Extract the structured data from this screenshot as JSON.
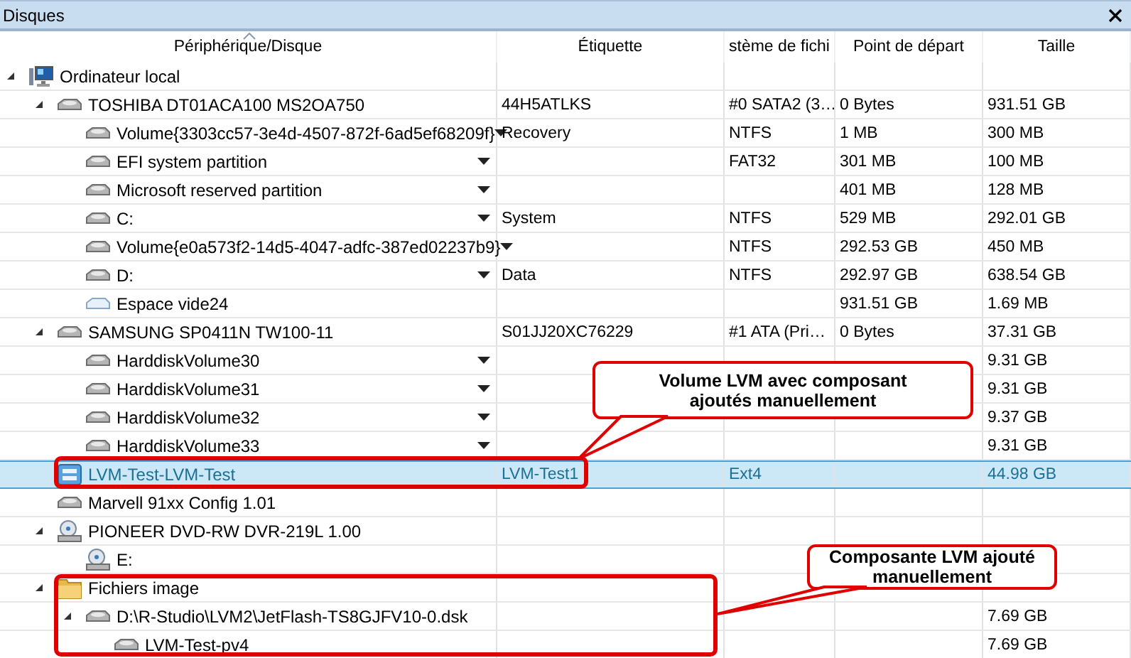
{
  "panel": {
    "title": "Disques"
  },
  "columns": [
    "Périphérique/Disque",
    "Étiquette",
    "stème de fichi",
    "Point de départ",
    "Taille"
  ],
  "tree": [
    {
      "name": "Ordinateur local",
      "kind": "computer",
      "expanded": true,
      "selected": false,
      "menu": false,
      "children": [
        {
          "name": "TOSHIBA DT01ACA100 MS2OA750",
          "kind": "disk",
          "expanded": true,
          "selected": false,
          "menu": false,
          "label": "44H5ATLKS",
          "filesystem": "#0 SATA2 (3…",
          "start": "0 Bytes",
          "size": "931.51 GB",
          "children": [
            {
              "name": "Volume{3303cc57-3e4d-4507-872f-6ad5ef68209f}",
              "kind": "disk",
              "selected": false,
              "menu": true,
              "label": "Recovery",
              "filesystem": "NTFS",
              "start": "1 MB",
              "size": "300 MB"
            },
            {
              "name": "EFI system partition",
              "kind": "disk",
              "selected": false,
              "menu": true,
              "filesystem": "FAT32",
              "start": "301 MB",
              "size": "100 MB"
            },
            {
              "name": "Microsoft reserved partition",
              "kind": "disk",
              "selected": false,
              "menu": true,
              "start": "401 MB",
              "size": "128 MB"
            },
            {
              "name": "C:",
              "kind": "disk",
              "selected": false,
              "menu": true,
              "label": "System",
              "filesystem": "NTFS",
              "start": "529 MB",
              "size": "292.01 GB"
            },
            {
              "name": "Volume{e0a573f2-14d5-4047-adfc-387ed02237b9}",
              "kind": "disk",
              "selected": false,
              "menu": true,
              "filesystem": "NTFS",
              "start": "292.53 GB",
              "size": "450 MB"
            },
            {
              "name": "D:",
              "kind": "disk",
              "selected": false,
              "menu": true,
              "label": "Data",
              "filesystem": "NTFS",
              "start": "292.97 GB",
              "size": "638.54 GB"
            },
            {
              "name": "Espace vide24",
              "kind": "empty",
              "selected": false,
              "menu": false,
              "start": "931.51 GB",
              "size": "1.69 MB"
            }
          ]
        },
        {
          "name": "SAMSUNG SP0411N TW100-11",
          "kind": "disk",
          "expanded": true,
          "selected": false,
          "menu": false,
          "label": "S01JJ20XC76229",
          "filesystem": "#1 ATA (Pri…",
          "start": "0 Bytes",
          "size": "37.31 GB",
          "children": [
            {
              "name": "HarddiskVolume30",
              "kind": "disk",
              "selected": false,
              "menu": true,
              "size": "9.31 GB"
            },
            {
              "name": "HarddiskVolume31",
              "kind": "disk",
              "selected": false,
              "menu": true,
              "size": "9.31 GB"
            },
            {
              "name": "HarddiskVolume32",
              "kind": "disk",
              "selected": false,
              "menu": true,
              "size": "9.37 GB"
            },
            {
              "name": "HarddiskVolume33",
              "kind": "disk",
              "selected": false,
              "menu": true,
              "size": "9.31 GB"
            }
          ]
        },
        {
          "name": "LVM-Test-LVM-Test",
          "kind": "lvm",
          "selected": true,
          "menu": false,
          "label": "LVM-Test1",
          "filesystem": "Ext4",
          "size": "44.98 GB"
        },
        {
          "name": "Marvell 91xx Config 1.01",
          "kind": "disk",
          "selected": false,
          "menu": false
        },
        {
          "name": "PIONEER DVD-RW DVR-219L 1.00",
          "kind": "optical",
          "expanded": true,
          "selected": false,
          "menu": false,
          "children": [
            {
              "name": "E:",
              "kind": "optical",
              "selected": false,
              "menu": false
            }
          ]
        },
        {
          "name": "Fichiers image",
          "kind": "folder",
          "expanded": true,
          "selected": false,
          "menu": false,
          "children": [
            {
              "name": "D:\\R-Studio\\LVM2\\JetFlash-TS8GJFV10-0.dsk",
              "kind": "disk",
              "expanded": true,
              "selected": false,
              "menu": false,
              "size": "7.69 GB",
              "children": [
                {
                  "name": "LVM-Test-pv4",
                  "kind": "disk",
                  "selected": false,
                  "menu": false,
                  "size": "7.69 GB"
                }
              ]
            }
          ]
        }
      ]
    }
  ],
  "annotations": [
    {
      "text": "Volume LVM avec composant ajoutés manuellement"
    },
    {
      "text": "Composante LVM ajouté manuellement"
    }
  ]
}
